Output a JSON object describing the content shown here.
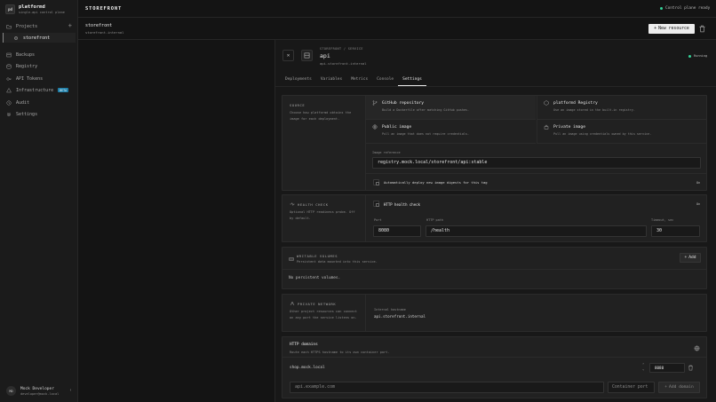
{
  "brand": {
    "logo": "pd",
    "name": "platformd",
    "tagline": "single-api control plane"
  },
  "sidebar": {
    "projects_label": "Projects",
    "add_symbol": "+",
    "current_project": "storefront",
    "items": [
      {
        "label": "Backups",
        "icon": "backup-icon"
      },
      {
        "label": "Registry",
        "icon": "registry-icon"
      },
      {
        "label": "API Tokens",
        "icon": "key-icon"
      },
      {
        "label": "Infrastructure",
        "icon": "infrastructure-icon",
        "badge": "BETA"
      },
      {
        "label": "Audit",
        "icon": "audit-icon"
      },
      {
        "label": "Settings",
        "icon": "gear-icon"
      }
    ]
  },
  "user": {
    "initials": "MD",
    "name": "Mock Developer",
    "email": "developer@mock.local"
  },
  "topbar": {
    "title": "STOREFRONT",
    "status": "Control plane ready",
    "status_color": "#34d399"
  },
  "project": {
    "name": "storefront",
    "host": "storefront.internal",
    "new_resource": "New resource"
  },
  "service": {
    "breadcrumb": "STOREFRONT / SERVICE",
    "name": "api",
    "host": "api.storefront.internal",
    "status": "Running",
    "tabs": [
      "Deployments",
      "Variables",
      "Metrics",
      "Console",
      "Settings"
    ],
    "active_tab": "Settings"
  },
  "source": {
    "title": "SOURCE",
    "desc": "Choose how platformd obtains the image for each deployment.",
    "options": [
      {
        "title": "GitHub repository",
        "desc": "Build a Dockerfile after matching GitHub pushes."
      },
      {
        "title": "platformd Registry",
        "desc": "Use an image stored in the built-in registry."
      },
      {
        "title": "Public image",
        "desc": "Pull an image that does not require credentials."
      },
      {
        "title": "Private image",
        "desc": "Pull an image using credentials owned by this service."
      }
    ],
    "image_ref_label": "Image reference",
    "image_ref": "registry.mock.local/storefront/api:stable",
    "autodeploy_label": "Automatically deploy new image digests for this tag",
    "autodeploy_state": "On"
  },
  "health": {
    "title": "HEALTH CHECK",
    "desc": "Optional HTTP readiness probe. Off by default.",
    "toggle_label": "HTTP health check",
    "toggle_state": "On",
    "port_label": "Port",
    "port": "8080",
    "path_label": "HTTP path",
    "path": "/health",
    "timeout_label": "Timeout, sec",
    "timeout": "30"
  },
  "volumes": {
    "title": "WRITABLE VOLUMES",
    "desc": "Persistent data mounted into this service.",
    "add": "Add",
    "empty": "No persistent volumes."
  },
  "network": {
    "title": "PRIVATE NETWORK",
    "desc": "Other project resources can connect on any port the service listens on.",
    "hostname_label": "Internal hostname",
    "hostname": "api.storefront.internal"
  },
  "domains": {
    "title": "HTTP domains",
    "desc": "Route each HTTPS hostname to its own container port.",
    "entries": [
      {
        "host": "shop.mock.local",
        "port": "8080"
      }
    ],
    "new_placeholder": "api.example.com",
    "port_placeholder": "Container port",
    "add": "Add domain"
  }
}
